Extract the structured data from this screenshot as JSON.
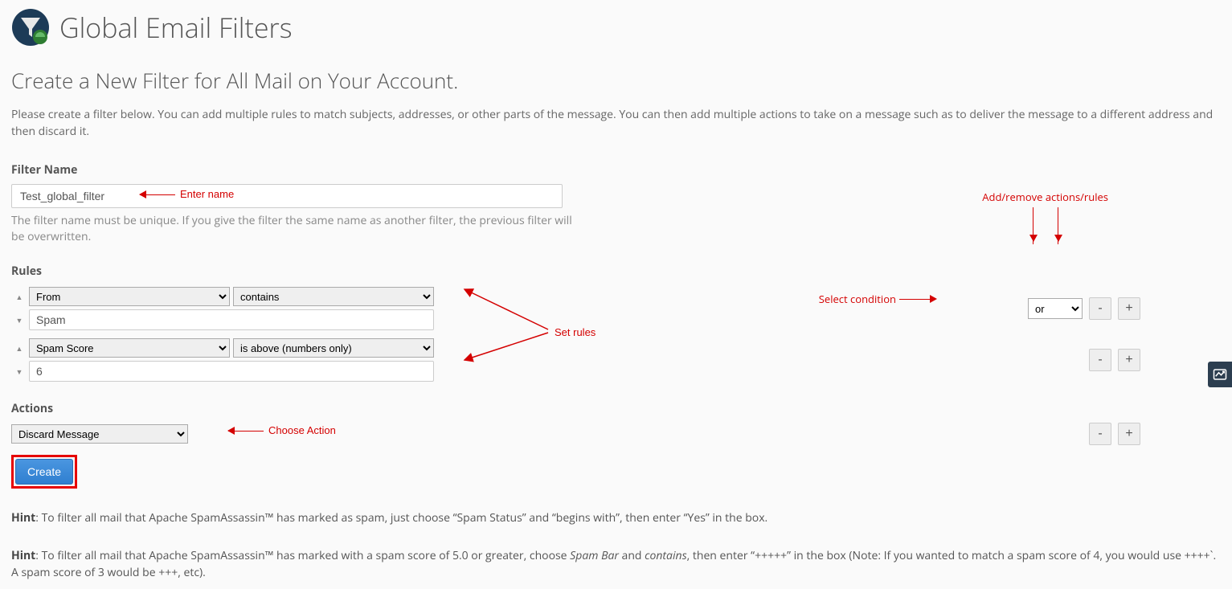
{
  "header": {
    "title": "Global Email Filters"
  },
  "subheading": "Create a New Filter for All Mail on Your Account.",
  "intro": "Please create a filter below. You can add multiple rules to match subjects, addresses, or other parts of the message. You can then add multiple actions to take on a message such as to deliver the message to a different address and then discard it.",
  "filter_name": {
    "label": "Filter Name",
    "value": "Test_global_filter",
    "help": "The filter name must be unique. If you give the filter the same name as another filter, the previous filter will be overwritten."
  },
  "rules": {
    "label": "Rules",
    "rows": [
      {
        "part": "From",
        "condition": "contains",
        "value": "Spam",
        "join": "or"
      },
      {
        "part": "Spam Score",
        "condition": "is above (numbers only)",
        "value": "6",
        "join": ""
      }
    ],
    "remove_label": "-",
    "add_label": "+"
  },
  "actions": {
    "label": "Actions",
    "selected": "Discard Message",
    "remove_label": "-",
    "add_label": "+"
  },
  "create_label": "Create",
  "hint1": {
    "prefix": "Hint",
    "text": ": To filter all mail that Apache SpamAssassin™ has marked as spam, just choose “Spam Status” and “begins with”, then enter “Yes” in the box."
  },
  "hint2": {
    "prefix": "Hint",
    "before": ": To filter all mail that Apache SpamAssassin™ has marked with a spam score of 5.0 or greater, choose ",
    "em1": "Spam Bar",
    "mid": " and ",
    "em2": "contains",
    "after": ", then enter “+++++” in the box (Note: If you wanted to match a spam score of 4, you would use ++++`. A spam score of 3 would be +++, etc)."
  },
  "annotations": {
    "enter_name": "Enter name",
    "set_rules": "Set rules",
    "select_condition": "Select condition",
    "add_remove": "Add/remove actions/rules",
    "choose_action": "Choose Action"
  }
}
